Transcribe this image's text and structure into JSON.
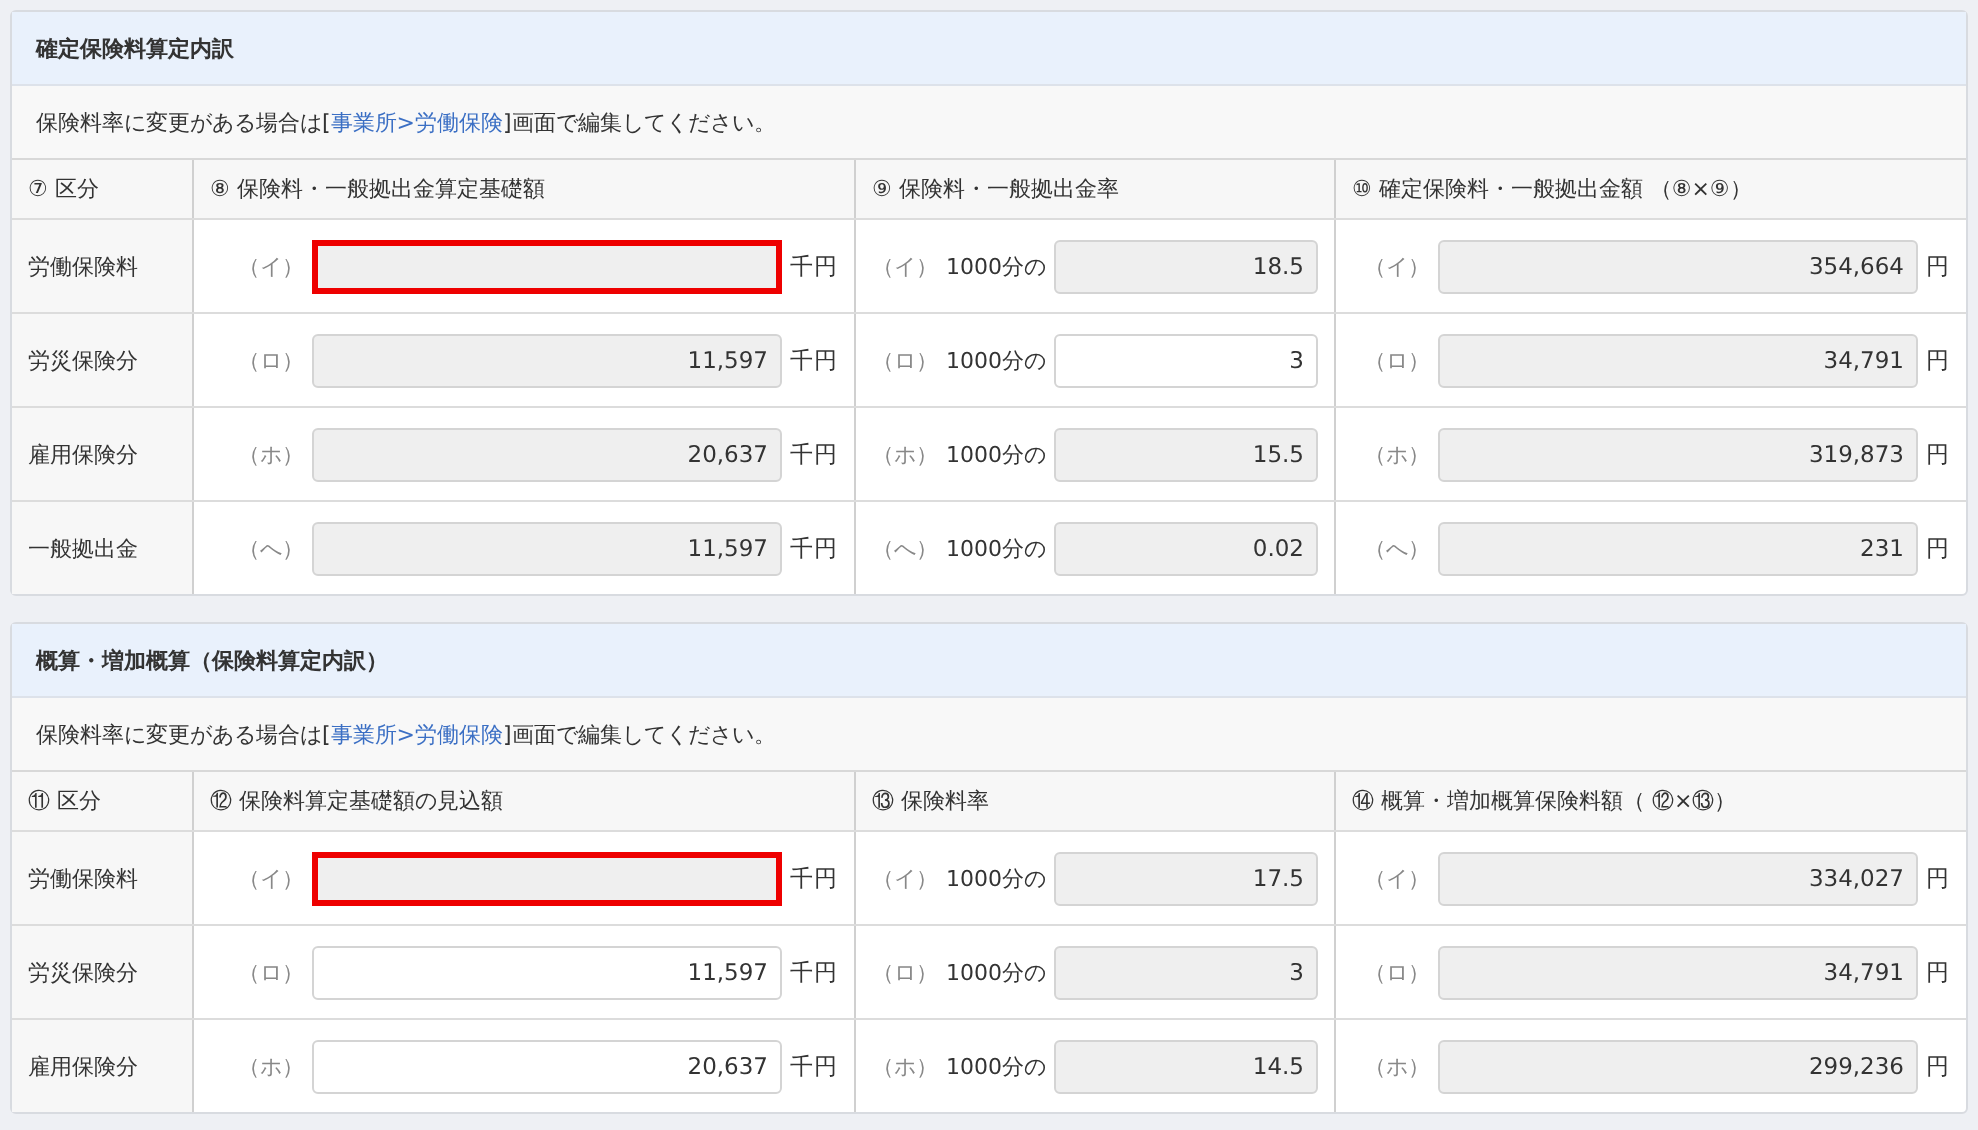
{
  "sections": [
    {
      "title": "確定保険料算定内訳",
      "notice": {
        "before": "保険料率に変更がある場合は[",
        "link": "事業所>労働保険",
        "after": "]画面で編集してください。"
      },
      "columns": [
        "⑦ 区分",
        "⑧ 保険料・一般拠出金算定基礎額",
        "⑨ 保険料・一般拠出金率",
        "⑩ 確定保険料・一般拠出金額 （⑧×⑨）"
      ],
      "rows": [
        {
          "category": "労働保険料",
          "base": {
            "prefix": "（イ）",
            "unit": "千円",
            "editable": false,
            "highlighted": true
          },
          "rate": {
            "prefix": "（イ）",
            "label": "1000分の",
            "value": "18.5",
            "editable": false
          },
          "amount": {
            "prefix": "（イ）",
            "value": "354,664",
            "unit": "円",
            "editable": false
          }
        },
        {
          "category": "労災保険分",
          "base": {
            "prefix": "（ロ）",
            "value": "11,597",
            "unit": "千円",
            "editable": false,
            "highlighted": false
          },
          "rate": {
            "prefix": "（ロ）",
            "label": "1000分の",
            "value": "3",
            "editable": true
          },
          "amount": {
            "prefix": "（ロ）",
            "value": "34,791",
            "unit": "円",
            "editable": false
          }
        },
        {
          "category": "雇用保険分",
          "base": {
            "prefix": "（ホ）",
            "value": "20,637",
            "unit": "千円",
            "editable": false,
            "highlighted": false
          },
          "rate": {
            "prefix": "（ホ）",
            "label": "1000分の",
            "value": "15.5",
            "editable": false
          },
          "amount": {
            "prefix": "（ホ）",
            "value": "319,873",
            "unit": "円",
            "editable": false
          }
        },
        {
          "category": "一般拠出金",
          "base": {
            "prefix": "（へ）",
            "value": "11,597",
            "unit": "千円",
            "editable": false,
            "highlighted": false
          },
          "rate": {
            "prefix": "（へ）",
            "label": "1000分の",
            "value": "0.02",
            "editable": false
          },
          "amount": {
            "prefix": "（へ）",
            "value": "231",
            "unit": "円",
            "editable": false
          }
        }
      ]
    },
    {
      "title": "概算・増加概算（保険料算定内訳）",
      "notice": {
        "before": "保険料率に変更がある場合は[",
        "link": "事業所>労働保険",
        "after": "]画面で編集してください。"
      },
      "columns": [
        "⑪ 区分",
        "⑫ 保険料算定基礎額の見込額",
        "⑬ 保険料率",
        "⑭ 概算・増加概算保険料額（ ⑫×⑬）"
      ],
      "rows": [
        {
          "category": "労働保険料",
          "base": {
            "prefix": "（イ）",
            "unit": "千円",
            "editable": false,
            "highlighted": true
          },
          "rate": {
            "prefix": "（イ）",
            "label": "1000分の",
            "value": "17.5",
            "editable": false
          },
          "amount": {
            "prefix": "（イ）",
            "value": "334,027",
            "unit": "円",
            "editable": false
          }
        },
        {
          "category": "労災保険分",
          "base": {
            "prefix": "（ロ）",
            "value": "11,597",
            "unit": "千円",
            "editable": true,
            "highlighted": false
          },
          "rate": {
            "prefix": "（ロ）",
            "label": "1000分の",
            "value": "3",
            "editable": false
          },
          "amount": {
            "prefix": "（ロ）",
            "value": "34,791",
            "unit": "円",
            "editable": false
          }
        },
        {
          "category": "雇用保険分",
          "base": {
            "prefix": "（ホ）",
            "value": "20,637",
            "unit": "千円",
            "editable": true,
            "highlighted": false
          },
          "rate": {
            "prefix": "（ホ）",
            "label": "1000分の",
            "value": "14.5",
            "editable": false
          },
          "amount": {
            "prefix": "（ホ）",
            "value": "299,236",
            "unit": "円",
            "editable": false
          }
        }
      ]
    }
  ]
}
